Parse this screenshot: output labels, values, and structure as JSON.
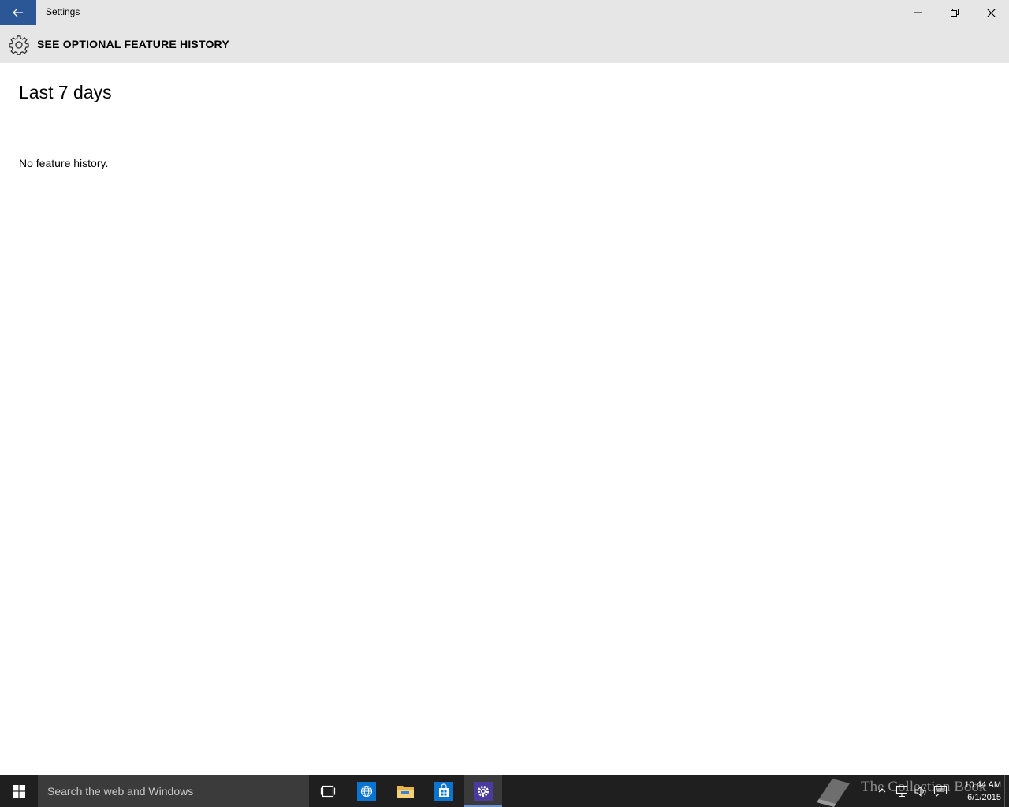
{
  "window": {
    "title": "Settings"
  },
  "header": {
    "page_title": "SEE OPTIONAL FEATURE HISTORY"
  },
  "content": {
    "section_heading": "Last 7 days",
    "empty_message": "No feature history."
  },
  "taskbar": {
    "search_placeholder": "Search the web and Windows",
    "pinned": [
      "task-view",
      "internet-explorer",
      "file-explorer",
      "store",
      "settings"
    ],
    "active_app": "settings",
    "watermark": "The Collection Book",
    "clock": {
      "time": "10:44 AM",
      "date": "6/1/2015"
    }
  },
  "colors": {
    "accent": "#2b5797",
    "titlebar_bg": "#e6e6e6",
    "taskbar_bg": "#1f1f1f",
    "search_bg": "#3b3b3b",
    "settings_icon_bg": "#4c3b9e",
    "store_icon_bg": "#0a74d0",
    "ie_icon_bg": "#0a74d0"
  }
}
